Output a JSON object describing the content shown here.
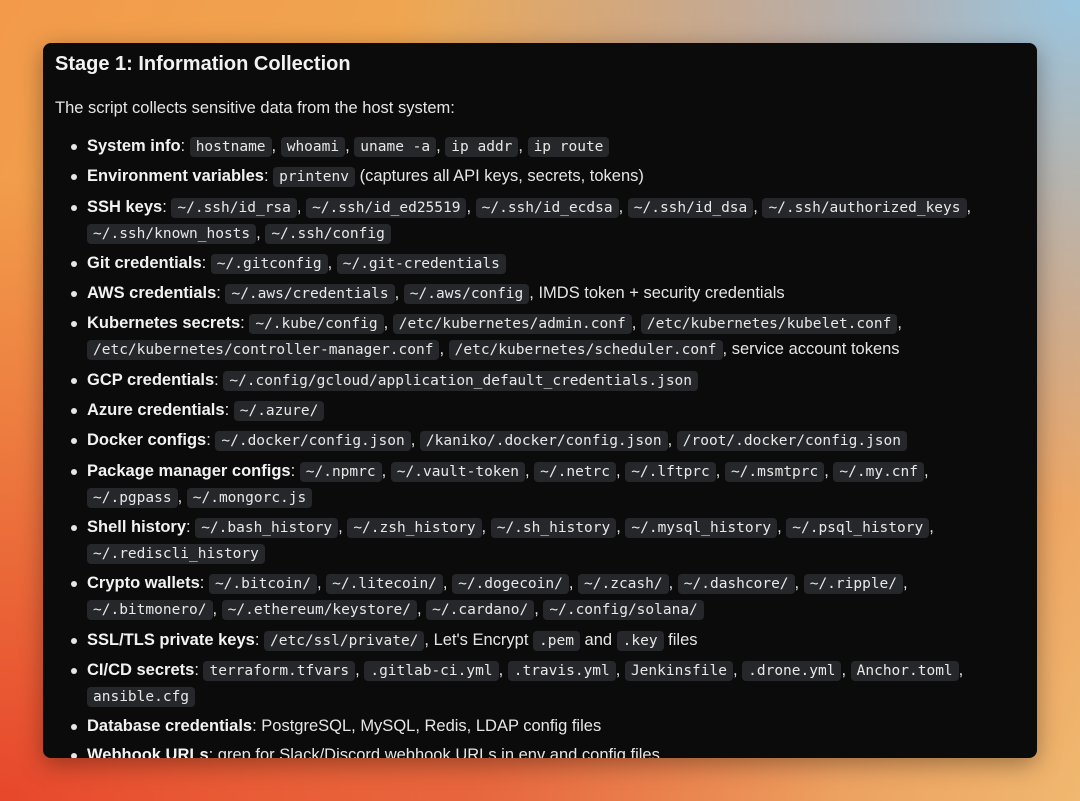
{
  "title": "Stage 1: Information Collection",
  "intro": "The script collects sensitive data from the host system:",
  "items": [
    {
      "label": "System info",
      "parts": [
        {
          "c": "hostname"
        },
        {
          "t": ", "
        },
        {
          "c": "whoami"
        },
        {
          "t": ", "
        },
        {
          "c": "uname -a"
        },
        {
          "t": ", "
        },
        {
          "c": "ip addr"
        },
        {
          "t": ", "
        },
        {
          "c": "ip route"
        }
      ]
    },
    {
      "label": "Environment variables",
      "parts": [
        {
          "c": "printenv"
        },
        {
          "t": " (captures all API keys, secrets, tokens)"
        }
      ]
    },
    {
      "label": "SSH keys",
      "parts": [
        {
          "c": "~/.ssh/id_rsa"
        },
        {
          "t": ", "
        },
        {
          "c": "~/.ssh/id_ed25519"
        },
        {
          "t": ", "
        },
        {
          "c": "~/.ssh/id_ecdsa"
        },
        {
          "t": ", "
        },
        {
          "c": "~/.ssh/id_dsa"
        },
        {
          "t": ", "
        },
        {
          "c": "~/.ssh/authorized_keys"
        },
        {
          "t": ", "
        },
        {
          "c": "~/.ssh/known_hosts"
        },
        {
          "t": ", "
        },
        {
          "c": "~/.ssh/config"
        }
      ]
    },
    {
      "label": "Git credentials",
      "parts": [
        {
          "c": "~/.gitconfig"
        },
        {
          "t": ", "
        },
        {
          "c": "~/.git-credentials"
        }
      ]
    },
    {
      "label": "AWS credentials",
      "parts": [
        {
          "c": "~/.aws/credentials"
        },
        {
          "t": ", "
        },
        {
          "c": "~/.aws/config"
        },
        {
          "t": ", IMDS token + security credentials"
        }
      ]
    },
    {
      "label": "Kubernetes secrets",
      "parts": [
        {
          "c": "~/.kube/config"
        },
        {
          "t": ", "
        },
        {
          "c": "/etc/kubernetes/admin.conf"
        },
        {
          "t": ", "
        },
        {
          "c": "/etc/kubernetes/kubelet.conf"
        },
        {
          "t": ", "
        },
        {
          "c": "/etc/kubernetes/controller-manager.conf"
        },
        {
          "t": ", "
        },
        {
          "c": "/etc/kubernetes/scheduler.conf"
        },
        {
          "t": ", service account tokens"
        }
      ]
    },
    {
      "label": "GCP credentials",
      "parts": [
        {
          "c": "~/.config/gcloud/application_default_credentials.json"
        }
      ]
    },
    {
      "label": "Azure credentials",
      "parts": [
        {
          "c": "~/.azure/"
        }
      ]
    },
    {
      "label": "Docker configs",
      "parts": [
        {
          "c": "~/.docker/config.json"
        },
        {
          "t": ", "
        },
        {
          "c": "/kaniko/.docker/config.json"
        },
        {
          "t": ", "
        },
        {
          "c": "/root/.docker/config.json"
        }
      ]
    },
    {
      "label": "Package manager configs",
      "parts": [
        {
          "c": "~/.npmrc"
        },
        {
          "t": ", "
        },
        {
          "c": "~/.vault-token"
        },
        {
          "t": ", "
        },
        {
          "c": "~/.netrc"
        },
        {
          "t": ", "
        },
        {
          "c": "~/.lftprc"
        },
        {
          "t": ", "
        },
        {
          "c": "~/.msmtprc"
        },
        {
          "t": ", "
        },
        {
          "c": "~/.my.cnf"
        },
        {
          "t": ", "
        },
        {
          "c": "~/.pgpass"
        },
        {
          "t": ", "
        },
        {
          "c": "~/.mongorc.js"
        }
      ]
    },
    {
      "label": "Shell history",
      "parts": [
        {
          "c": "~/.bash_history"
        },
        {
          "t": ", "
        },
        {
          "c": "~/.zsh_history"
        },
        {
          "t": ", "
        },
        {
          "c": "~/.sh_history"
        },
        {
          "t": ", "
        },
        {
          "c": "~/.mysql_history"
        },
        {
          "t": ", "
        },
        {
          "c": "~/.psql_history"
        },
        {
          "t": ", "
        },
        {
          "c": "~/.rediscli_history"
        }
      ]
    },
    {
      "label": "Crypto wallets",
      "parts": [
        {
          "c": "~/.bitcoin/"
        },
        {
          "t": ", "
        },
        {
          "c": "~/.litecoin/"
        },
        {
          "t": ", "
        },
        {
          "c": "~/.dogecoin/"
        },
        {
          "t": ", "
        },
        {
          "c": "~/.zcash/"
        },
        {
          "t": ", "
        },
        {
          "c": "~/.dashcore/"
        },
        {
          "t": ", "
        },
        {
          "c": "~/.ripple/"
        },
        {
          "t": ", "
        },
        {
          "c": "~/.bitmonero/"
        },
        {
          "t": ", "
        },
        {
          "c": "~/.ethereum/keystore/"
        },
        {
          "t": ", "
        },
        {
          "c": "~/.cardano/"
        },
        {
          "t": ", "
        },
        {
          "c": "~/.config/solana/"
        }
      ]
    },
    {
      "label": "SSL/TLS private keys",
      "parts": [
        {
          "c": "/etc/ssl/private/"
        },
        {
          "t": ", Let's Encrypt "
        },
        {
          "c": ".pem"
        },
        {
          "t": " and "
        },
        {
          "c": ".key"
        },
        {
          "t": " files"
        }
      ]
    },
    {
      "label": "CI/CD secrets",
      "parts": [
        {
          "c": "terraform.tfvars"
        },
        {
          "t": ", "
        },
        {
          "c": ".gitlab-ci.yml"
        },
        {
          "t": ", "
        },
        {
          "c": ".travis.yml"
        },
        {
          "t": ", "
        },
        {
          "c": "Jenkinsfile"
        },
        {
          "t": ", "
        },
        {
          "c": ".drone.yml"
        },
        {
          "t": ", "
        },
        {
          "c": "Anchor.toml"
        },
        {
          "t": ", "
        },
        {
          "c": "ansible.cfg"
        }
      ]
    },
    {
      "label": "Database credentials",
      "parts": [
        {
          "t": " PostgreSQL, MySQL, Redis, LDAP config files"
        }
      ]
    },
    {
      "label": "Webhook URLs",
      "parts": [
        {
          "t": " grep for Slack/Discord webhook URLs in env and config files"
        }
      ]
    }
  ]
}
